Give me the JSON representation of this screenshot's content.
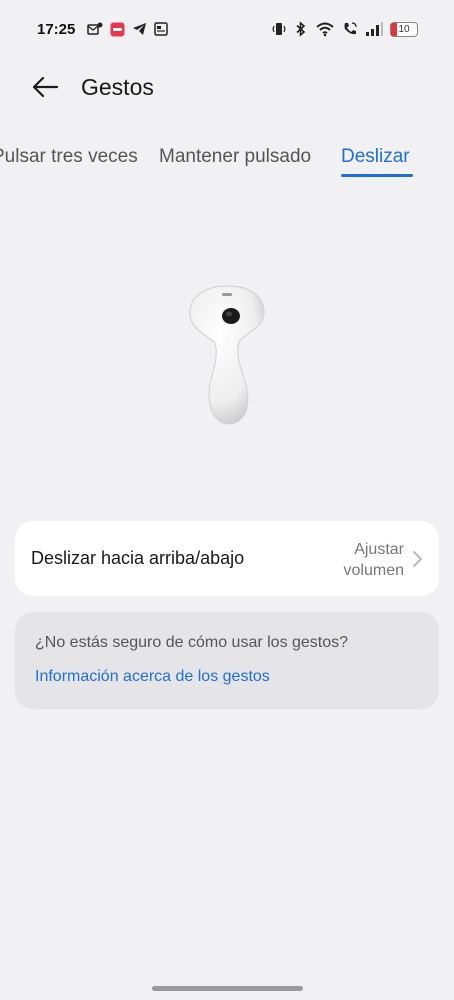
{
  "status_bar": {
    "time": "17:25",
    "battery_level": "10",
    "notification_icons": [
      "email-badge-icon",
      "app-badge-icon",
      "telegram-icon",
      "news-icon"
    ],
    "system_icons": [
      "vibrate-icon",
      "bluetooth-icon",
      "wifi-icon",
      "wifi-calling-icon",
      "signal-icon",
      "battery-icon"
    ]
  },
  "header": {
    "title": "Gestos"
  },
  "tabs": [
    {
      "label": "Pulsar tres veces",
      "active": false
    },
    {
      "label": "Mantener pulsado",
      "active": false
    },
    {
      "label": "Deslizar",
      "active": true
    }
  ],
  "setting": {
    "label": "Deslizar hacia arriba/abajo",
    "value_line1": "Ajustar",
    "value_line2": "volumen"
  },
  "help": {
    "question": "¿No estás seguro de cómo usar los gestos?",
    "link": "Información acerca de los gestos"
  },
  "colors": {
    "accent": "#1e6fd9",
    "background": "#f1f1f3",
    "card": "#ffffff",
    "help_card": "#e5e5e8"
  }
}
